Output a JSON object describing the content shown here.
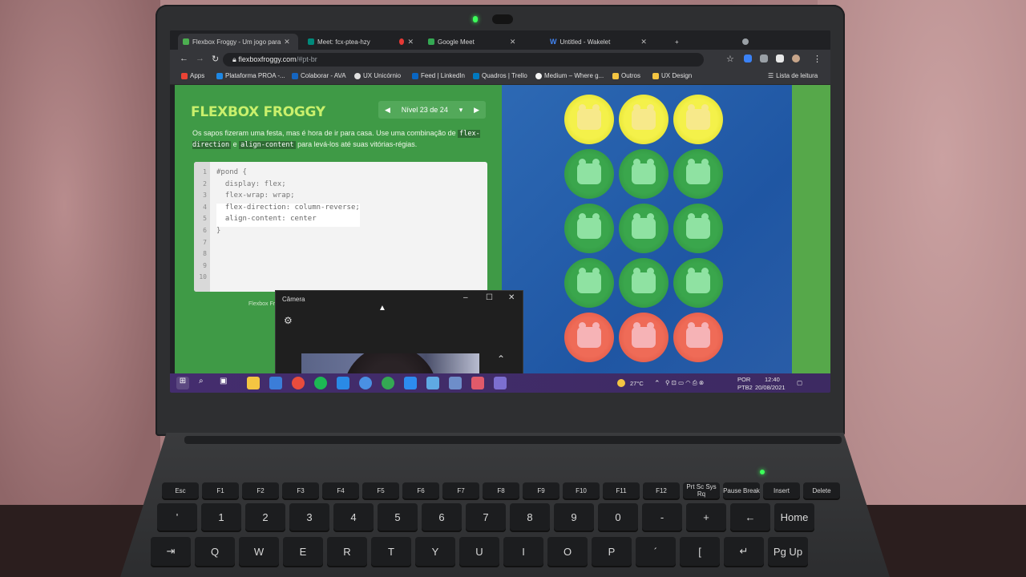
{
  "browser": {
    "tabs": [
      {
        "label": "Flexbox Froggy - Um jogo para",
        "active": true,
        "favicon_color": "#4caf50"
      },
      {
        "label": "Meet: fcx-ptea-hzy",
        "active": false,
        "favicon_color": "#00897b"
      },
      {
        "label": "Google Meet",
        "active": false,
        "favicon_color": "#34a853"
      },
      {
        "label": "Untitled - Wakelet",
        "active": false,
        "favicon_color": "#4285f4"
      }
    ],
    "url_host": "flexboxfroggy.com",
    "url_path": "/#pt-br",
    "bookmarks": [
      "Apps",
      "Plataforma PROA -...",
      "Colaborar - AVA",
      "UX Unicórnio",
      "Feed | LinkedIn",
      "Quadros | Trello",
      "Medium – Where g...",
      "Outros",
      "UX Design"
    ],
    "reading_list": "Lista de leitura"
  },
  "game": {
    "logo": "FLEXBOX FROGGY",
    "level_label": "Nível 23 de 24",
    "instructions": {
      "text_1": "Os sapos fizeram uma festa, mas é hora de ir para casa. Use uma combinação de",
      "code_1": "flex-direction",
      "joiner": "e",
      "code_2": "align-content",
      "text_2": "para levá-los até suas vitórias-régias."
    },
    "line_numbers": [
      "1",
      "2",
      "3",
      "4",
      "5",
      "6",
      "7",
      "8",
      "9",
      "10"
    ],
    "code_lines": [
      "#pond {",
      "  display: flex;",
      "  flex-wrap: wrap;",
      "  flex-direction: column-reverse;",
      "  align-content: center",
      "}"
    ],
    "footnote": "Flexbox Fr",
    "pond": [
      [
        "yellow",
        "yellow",
        "yellow"
      ],
      [
        "green",
        "green",
        "green"
      ],
      [
        "green",
        "green",
        "green"
      ],
      [
        "green",
        "green",
        "green"
      ],
      [
        "red",
        "red",
        "red"
      ]
    ]
  },
  "camera_app": {
    "title": "Câmera",
    "minimize": "–",
    "maximize": "☐",
    "close": "✕"
  },
  "taskbar": {
    "weather": "27°C",
    "language_1": "POR",
    "language_2": "PTB2",
    "time": "12:40",
    "date": "20/08/2021"
  },
  "keyboard": {
    "row_fn": [
      "Esc",
      "F1",
      "F2",
      "F3",
      "F4",
      "F5",
      "F6",
      "F7",
      "F8",
      "F9",
      "F10",
      "F11",
      "F12",
      "Prt Sc Sys Rq",
      "Pause Break",
      "Insert",
      "Delete"
    ],
    "row_num": [
      "'",
      "1",
      "2",
      "3",
      "4",
      "5",
      "6",
      "7",
      "8",
      "9",
      "0",
      "-",
      "+",
      "←",
      "Home"
    ],
    "row_top": [
      "⇥",
      "Q",
      "W",
      "E",
      "R",
      "T",
      "Y",
      "U",
      "I",
      "O",
      "P",
      "´",
      "[",
      "↵",
      "Pg Up"
    ]
  },
  "colors": {
    "game_green": "#3f9a46",
    "pond_blue": "#2d69b4",
    "logo_lime": "#c9f06c",
    "taskbar_purple": "#442d6e"
  }
}
